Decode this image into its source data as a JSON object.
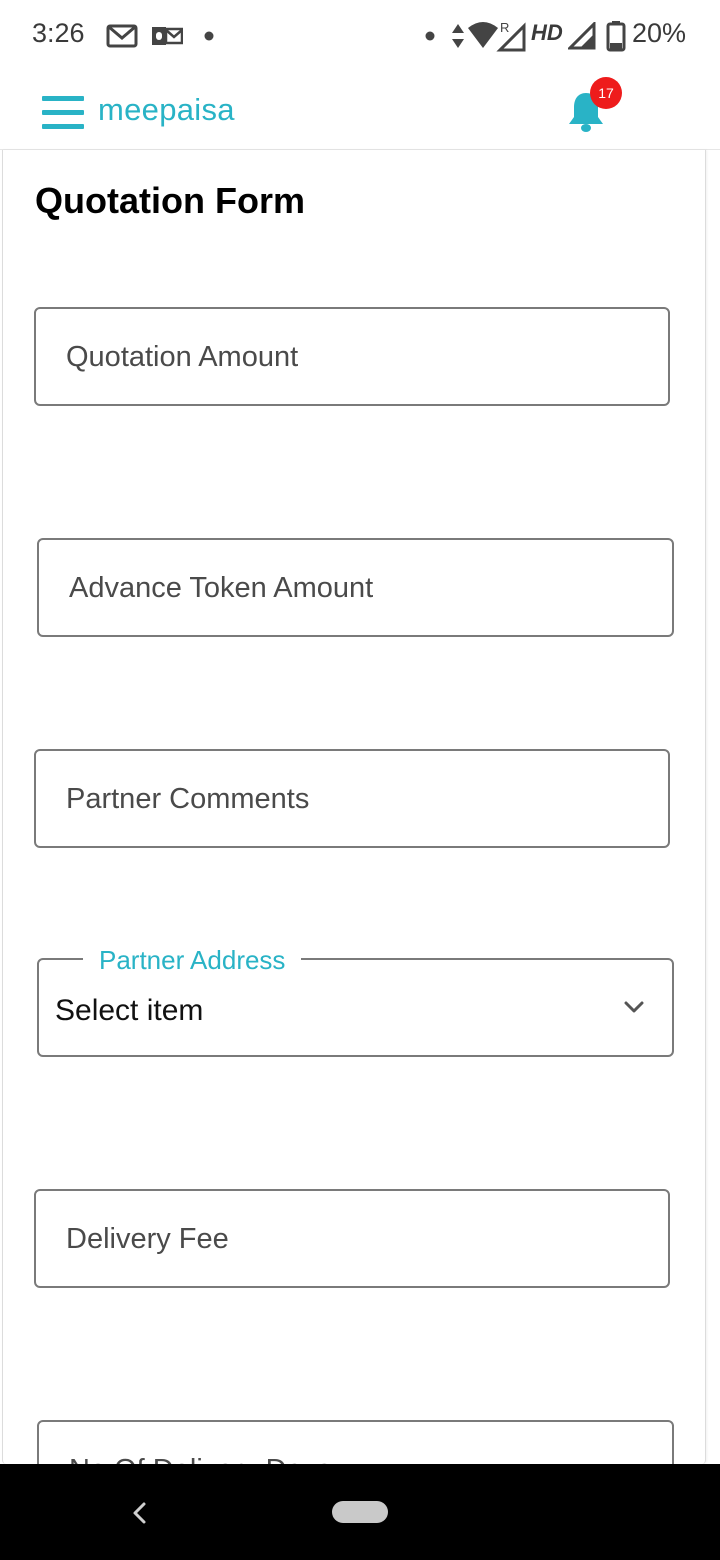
{
  "status_bar": {
    "time": "3:26",
    "network_label": "HD",
    "battery": "20%"
  },
  "app_bar": {
    "brand": "meepaisa",
    "notification_count": "17",
    "accent_color": "#29b3c6",
    "badge_color": "#ee1c1c"
  },
  "form": {
    "title": "Quotation Form",
    "fields": [
      {
        "placeholder": "Quotation Amount"
      },
      {
        "placeholder": "Advance Token Amount"
      },
      {
        "placeholder": "Partner Comments"
      },
      {
        "placeholder": "Delivery Fee"
      },
      {
        "placeholder": "No Of Delivery Days"
      }
    ],
    "partner_address": {
      "label": "Partner Address",
      "value": "Select item"
    }
  },
  "icons": {
    "menu": "hamburger-menu-icon",
    "notifications": "bell-icon",
    "dropdown": "chevron-down-icon",
    "back": "back-triangle-icon",
    "home": "home-pill-icon"
  }
}
